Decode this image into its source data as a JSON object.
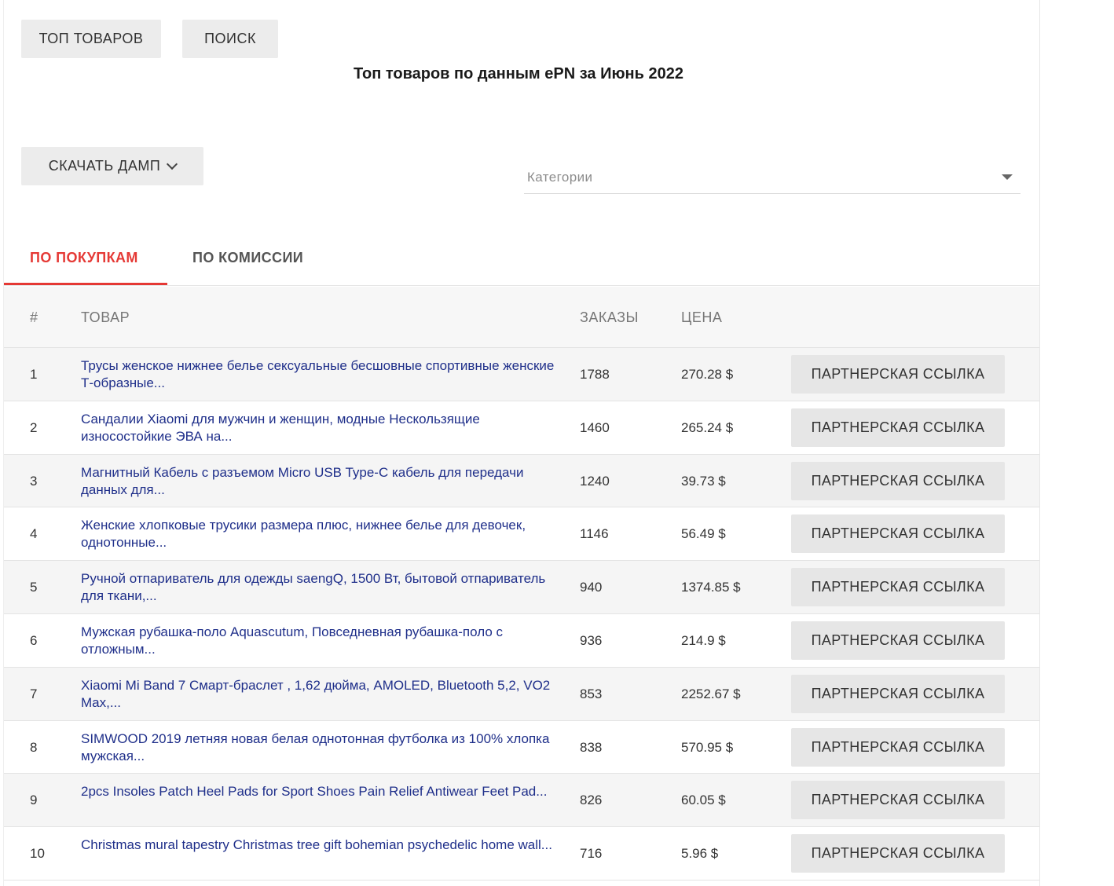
{
  "header": {
    "top_button": "ТОП ТОВАРОВ",
    "search_button": "ПОИСК",
    "title": "Топ товаров по данным ePN за Июнь 2022",
    "dump_button": "СКАЧАТЬ ДАМП",
    "categories_placeholder": "Категории"
  },
  "tabs": [
    {
      "label": "ПО ПОКУПКАМ",
      "active": true
    },
    {
      "label": "ПО КОМИССИИ",
      "active": false
    }
  ],
  "table": {
    "columns": [
      "#",
      "ТОВАР",
      "ЗАКАЗЫ",
      "ЦЕНА"
    ],
    "link_label": "ПАРТНЕРСКАЯ ССЫЛКА",
    "rows": [
      {
        "num": "1",
        "name": "Трусы женское нижнее белье сексуальные бесшовные спортивные женские Т-образные...",
        "orders": "1788",
        "price": "270.28 $"
      },
      {
        "num": "2",
        "name": "Сандалии Xiaomi для мужчин и женщин, модные Нескользящие износостойкие ЭВА на...",
        "orders": "1460",
        "price": "265.24 $"
      },
      {
        "num": "3",
        "name": "Магнитный Кабель с разъемом Micro USB Type-C кабель для передачи данных для...",
        "orders": "1240",
        "price": "39.73 $"
      },
      {
        "num": "4",
        "name": "Женские хлопковые трусики размера плюс, нижнее белье для девочек, однотонные...",
        "orders": "1146",
        "price": "56.49 $"
      },
      {
        "num": "5",
        "name": "Ручной отпариватель для одежды saengQ, 1500 Вт, бытовой отпариватель для ткани,...",
        "orders": "940",
        "price": "1374.85 $"
      },
      {
        "num": "6",
        "name": "Мужская рубашка-поло Aquascutum, Повседневная рубашка-поло с отложным...",
        "orders": "936",
        "price": "214.9 $"
      },
      {
        "num": "7",
        "name": "Xiaomi Mi Band 7 Смарт-браслет , 1,62 дюйма, AMOLED, Bluetooth 5,2, VO2 Max,...",
        "orders": "853",
        "price": "2252.67 $"
      },
      {
        "num": "8",
        "name": "SIMWOOD 2019 летняя новая белая однотонная футболка из 100% хлопка мужская...",
        "orders": "838",
        "price": "570.95 $"
      },
      {
        "num": "9",
        "name": "2pcs Insoles Patch Heel Pads for Sport Shoes Pain Relief Antiwear Feet Pad...",
        "orders": "826",
        "price": "60.05 $"
      },
      {
        "num": "10",
        "name": "Christmas mural tapestry Christmas tree gift bohemian psychedelic home wall...",
        "orders": "716",
        "price": "5.96 $"
      }
    ]
  },
  "colors": {
    "accent": "#e53935",
    "link": "#1f2f8a",
    "button_bg": "#ececec"
  }
}
